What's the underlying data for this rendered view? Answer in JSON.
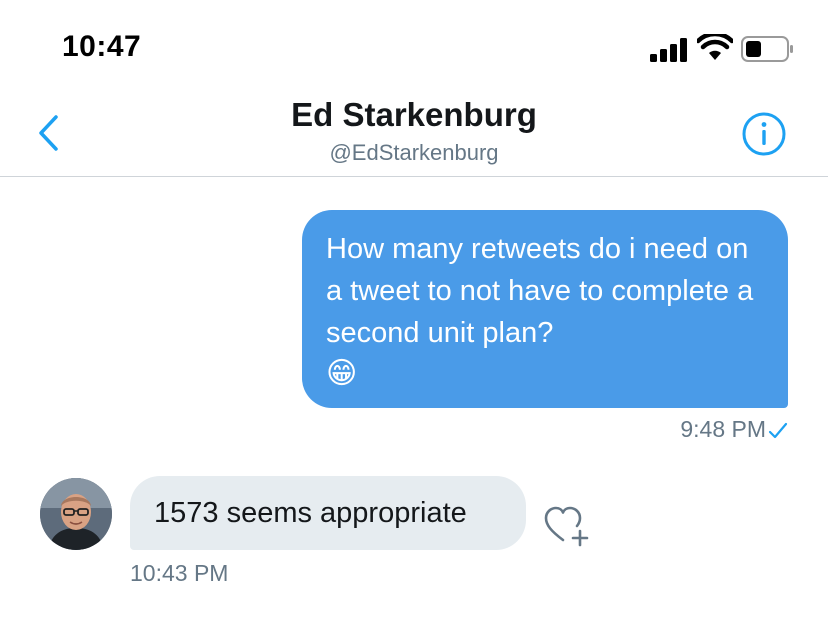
{
  "status_bar": {
    "time": "10:47",
    "icons": [
      "signal-icon",
      "wifi-icon",
      "battery-icon"
    ]
  },
  "header": {
    "name": "Ed Starkenburg",
    "handle": "@EdStarkenburg",
    "back_icon": "chevron-left-icon",
    "info_icon": "info-icon",
    "accent_color": "#1da1f2"
  },
  "messages": [
    {
      "direction": "sent",
      "text": "How many retweets do i need on a tweet to not have to complete a second unit plan?",
      "emoji": "😁",
      "time": "9:48 PM",
      "status_icon": "check-icon",
      "bubble_color": "#4a9be8"
    },
    {
      "direction": "received",
      "text": "1573 seems appropriate",
      "time": "10:43 PM",
      "like_icon": "heart-plus-icon",
      "bubble_color": "#e6ecf0"
    }
  ]
}
